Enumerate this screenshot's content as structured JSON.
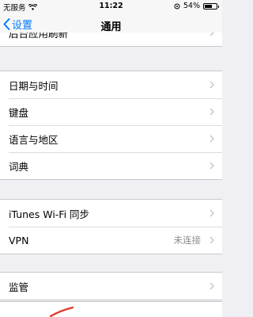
{
  "status_bar": {
    "carrier": "无服务",
    "time": "11:22",
    "battery": "54%",
    "battery_level": 0.54
  },
  "nav": {
    "back_label": "设置",
    "title": "通用"
  },
  "groups": [
    {
      "items": [
        {
          "label": "后台应用刷新"
        }
      ]
    },
    {
      "items": [
        {
          "label": "日期与时间"
        },
        {
          "label": "键盘"
        },
        {
          "label": "语言与地区"
        },
        {
          "label": "词典"
        }
      ]
    },
    {
      "items": [
        {
          "label": "iTunes Wi-Fi 同步"
        },
        {
          "label": "VPN",
          "value": "未连接"
        }
      ]
    },
    {
      "items": [
        {
          "label": "监管"
        }
      ]
    }
  ],
  "accent_color": "#007aff",
  "icons": [
    "wifi-icon",
    "chevron-left-icon",
    "chevron-right-icon",
    "location-icon",
    "battery-icon"
  ]
}
